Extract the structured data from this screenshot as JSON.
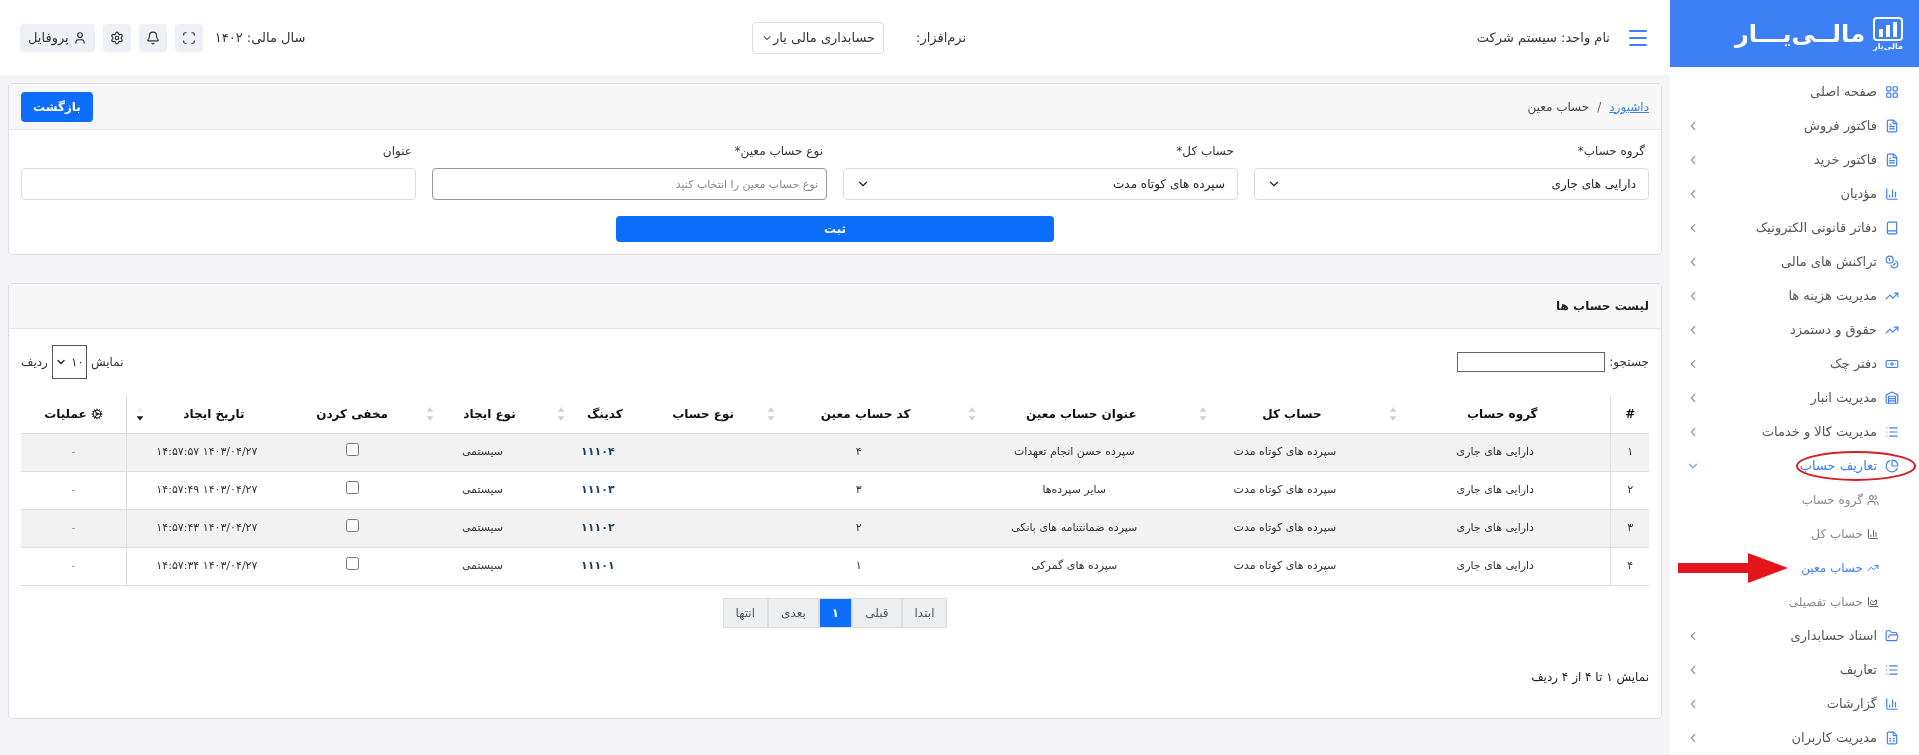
{
  "logo": {
    "text": "مالــی‌یـــار",
    "subtext": "مالی‌یار"
  },
  "header": {
    "unit_label": "نام واحد: سیستم شرکت",
    "software_label": "نرم‌افزار:",
    "software_value": "حسابداری مالی یار",
    "fiscal_year": "سال مالی: ۱۴۰۲",
    "profile_button": "پروفایل"
  },
  "sidebar": {
    "items": [
      {
        "label": "صفحه اصلی",
        "kind": "link",
        "selected": false
      },
      {
        "label": "فاکتور فروش",
        "kind": "group",
        "expanded": false,
        "selected": false
      },
      {
        "label": "فاکتور خرید",
        "kind": "group",
        "expanded": false,
        "selected": false
      },
      {
        "label": "مؤدیان",
        "kind": "group",
        "expanded": false,
        "selected": false
      },
      {
        "label": "دفاتر قانونی الکترونیک",
        "kind": "group",
        "expanded": false,
        "selected": false
      },
      {
        "label": "تراکنش های مالی",
        "kind": "group",
        "expanded": false,
        "selected": false
      },
      {
        "label": "مدیریت هزینه ها",
        "kind": "group",
        "expanded": false,
        "selected": false
      },
      {
        "label": "حقوق و دستمزد",
        "kind": "group",
        "expanded": false,
        "selected": false
      },
      {
        "label": "دفتر چک",
        "kind": "group",
        "expanded": false,
        "selected": false
      },
      {
        "label": "مدیریت انبار",
        "kind": "group",
        "expanded": false,
        "selected": false
      },
      {
        "label": "مدیریت کالا و خدمات",
        "kind": "group",
        "expanded": false,
        "selected": false
      },
      {
        "label": "تعاریف حساب",
        "kind": "group",
        "expanded": true,
        "selected": true,
        "children": [
          {
            "label": "گروه حساب",
            "selected": false
          },
          {
            "label": "حساب کل",
            "selected": false
          },
          {
            "label": "حساب معین",
            "selected": true
          },
          {
            "label": "حساب تفصیلی",
            "selected": false
          }
        ]
      },
      {
        "label": "اسناد حسابداری",
        "kind": "group",
        "expanded": false,
        "selected": false
      },
      {
        "label": "تعاریف",
        "kind": "group",
        "expanded": false,
        "selected": false
      },
      {
        "label": "گزارشات",
        "kind": "group",
        "expanded": false,
        "selected": false
      },
      {
        "label": "مدیریت کاربران",
        "kind": "group",
        "expanded": false,
        "selected": false
      }
    ]
  },
  "form_card": {
    "breadcrumb": [
      {
        "label": "داشبورد",
        "link": true
      },
      {
        "label": "حساب معین",
        "link": false
      }
    ],
    "breadcrumb_separator": "/",
    "back_button": "بازگشت",
    "fields": [
      {
        "kind": "select",
        "label": "گروه حساب*",
        "value": "دارایی های جاری"
      },
      {
        "kind": "select",
        "label": "حساب کل*",
        "value": "سپرده های کوتاه مدت"
      },
      {
        "kind": "input",
        "label": "نوع حساب معین*",
        "placeholder": "نوع حساب معین را انتخاب کنید"
      },
      {
        "kind": "input",
        "label": "عنوان"
      }
    ],
    "submit_button": "ثبت"
  },
  "list_card": {
    "title": "لیست حساب ها",
    "page_size": {
      "prefix": "نمایش",
      "value": "۱۰",
      "suffix": "ردیف"
    },
    "search_label": "جستجو:",
    "columns": [
      {
        "label": "#",
        "sortable": false
      },
      {
        "label": "گروه حساب",
        "sortable": true,
        "sorted": false
      },
      {
        "label": "حساب کل",
        "sortable": true,
        "sorted": false
      },
      {
        "label": "عنوان حساب معین",
        "sortable": true,
        "sorted": false
      },
      {
        "label": "کد حساب معین",
        "sortable": true,
        "sorted": false
      },
      {
        "label": "نوع حساب",
        "sortable": false
      },
      {
        "label": "کدینگ",
        "sortable": true,
        "sorted": false
      },
      {
        "label": "نوع ایجاد",
        "sortable": true,
        "sorted": false
      },
      {
        "label": "مخفی کردن",
        "sortable": false
      },
      {
        "label": "تاریخ ایجاد",
        "sortable": true,
        "sorted": true
      },
      {
        "label": "عملیات",
        "sortable": false
      }
    ],
    "rows": [
      {
        "number": "۱",
        "group": "دارایی های جاری",
        "general": "سپرده های کوتاه مدت",
        "title": "سپرده حسن انجام تعهدات",
        "code": "۴",
        "coding": "۱۱۱۰۴",
        "creation": "سیستمی",
        "hidden": false,
        "created": "۱۴۰۳/۰۴/۲۷ ۱۴:۵۷:۵۷",
        "actions": "-"
      },
      {
        "number": "۲",
        "group": "دارایی های جاری",
        "general": "سپرده های کوتاه مدت",
        "title": "سایر سپرده‌ها",
        "code": "۳",
        "coding": "۱۱۱۰۳",
        "creation": "سیستمی",
        "hidden": false,
        "created": "۱۴۰۳/۰۴/۲۷ ۱۴:۵۷:۴۹",
        "actions": "-"
      },
      {
        "number": "۳",
        "group": "دارایی های جاری",
        "general": "سپرده های کوتاه مدت",
        "title": "سپرده ضمانتنامه های بانکی",
        "code": "۲",
        "coding": "۱۱۱۰۲",
        "creation": "سیستمی",
        "hidden": false,
        "created": "۱۴۰۳/۰۴/۲۷ ۱۴:۵۷:۴۳",
        "actions": "-"
      },
      {
        "number": "۴",
        "group": "دارایی های جاری",
        "general": "سپرده های کوتاه مدت",
        "title": "سپرده های گمرکی",
        "code": "۱",
        "coding": "۱۱۱۰۱",
        "creation": "سیستمی",
        "hidden": false,
        "created": "۱۴۰۳/۰۴/۲۷ ۱۴:۵۷:۳۴",
        "actions": "-"
      }
    ],
    "pagination": [
      {
        "label": "ابتدا",
        "selected": false
      },
      {
        "label": "قبلی",
        "selected": false
      },
      {
        "label": "۱",
        "selected": true
      },
      {
        "label": "بعدی",
        "selected": false
      },
      {
        "label": "انتها",
        "selected": false
      }
    ],
    "info": "نمایش ۱ تا ۴ از ۴ ردیف"
  }
}
